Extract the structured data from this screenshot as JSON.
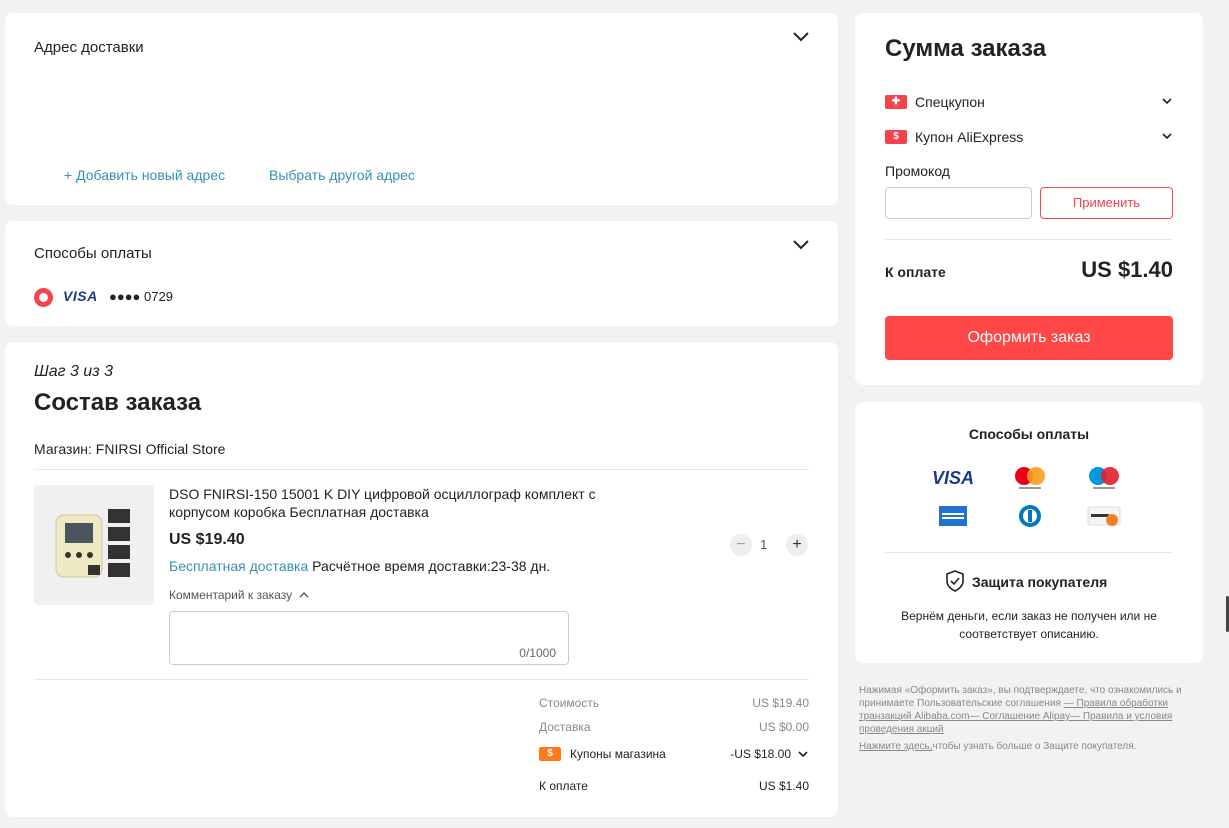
{
  "address": {
    "title": "Адрес доставки",
    "add_new": "+ Добавить новый адрес",
    "choose_other": "Выбрать другой адрес"
  },
  "payment": {
    "title": "Способы оплаты",
    "card_brand": "VISA",
    "card_masked": "●●●● 0729",
    "accent": "#f4434c"
  },
  "order": {
    "step": "Шаг 3 из 3",
    "title": "Состав заказа",
    "store": "Магазин: FNIRSI Official Store",
    "product": {
      "name": "DSO FNIRSI-150 15001 K DIY цифровой осциллограф комплект с корпусом коробка Бесплатная доставка",
      "price": "US $19.40",
      "free_shipping": "Бесплатная доставка",
      "delivery_time": "Расчётное время доставки:23-38 дн.",
      "quantity": "1",
      "minus": "−",
      "plus": "+"
    },
    "comment": {
      "label": "Комментарий к заказу",
      "counter": "0/1000"
    },
    "summary": {
      "cost_label": "Стоимость",
      "cost_value": "US $19.40",
      "delivery_label": "Доставка",
      "delivery_value": "US $0.00",
      "coupons_label": "Купоны магазина",
      "coupons_value": "-US $18.00",
      "total_label": "К оплате",
      "total_value": "US $1.40"
    }
  },
  "order_summary": {
    "title": "Сумма заказа",
    "special_coupon": "Спецкупон",
    "ali_coupon": "Купон AliExpress",
    "promo_label": "Промокод",
    "promo_placeholder": "",
    "apply": "Применить",
    "due_label": "К оплате",
    "due_value": "US $1.40",
    "checkout": "Оформить заказ",
    "checkout_color": "#ff4747"
  },
  "methods": {
    "title": "Способы оплаты",
    "logos": [
      "visa",
      "mastercard",
      "maestro",
      "american-express",
      "diners-club",
      "discover"
    ],
    "visa_text": "VISA",
    "protection_title": "Защита покупателя",
    "protection_desc": "Вернём деньги, если заказ не получен или не соответствует описанию."
  },
  "legal": {
    "text": "Нажимая «Оформить заказ», вы подтверждаете, что ознакомились и принимаете Пользовательские соглашения",
    "links": "— Правила обработки транзакций Alibaba.com— Соглашение Alipay— Правила и условия проведения акций",
    "click_here": "Нажмите здесь,",
    "protection_more": "чтобы узнать больше о Защите покупателя."
  }
}
